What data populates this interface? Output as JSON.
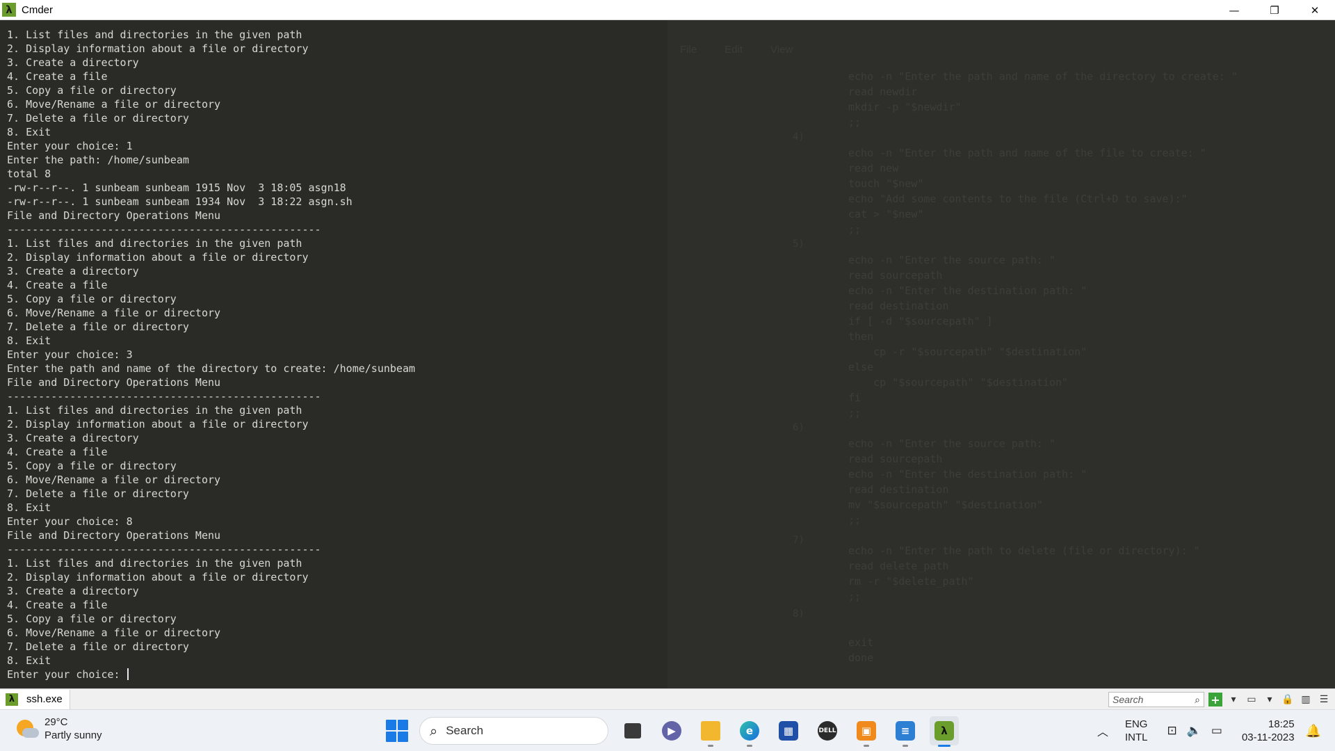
{
  "window": {
    "title": "Cmder",
    "app_icon": "λ",
    "controls": {
      "minimize": "—",
      "maximize": "❐",
      "close": "✕"
    }
  },
  "terminal": {
    "lines": [
      "1. List files and directories in the given path",
      "2. Display information about a file or directory",
      "3. Create a directory",
      "4. Create a file",
      "5. Copy a file or directory",
      "6. Move/Rename a file or directory",
      "7. Delete a file or directory",
      "8. Exit",
      "Enter your choice: 1",
      "Enter the path: /home/sunbeam",
      "total 8",
      "-rw-r--r--. 1 sunbeam sunbeam 1915 Nov  3 18:05 asgn18",
      "-rw-r--r--. 1 sunbeam sunbeam 1934 Nov  3 18:22 asgn.sh",
      "File and Directory Operations Menu",
      "--------------------------------------------------",
      "1. List files and directories in the given path",
      "2. Display information about a file or directory",
      "3. Create a directory",
      "4. Create a file",
      "5. Copy a file or directory",
      "6. Move/Rename a file or directory",
      "7. Delete a file or directory",
      "8. Exit",
      "Enter your choice: 3",
      "Enter the path and name of the directory to create: /home/sunbeam",
      "File and Directory Operations Menu",
      "--------------------------------------------------",
      "1. List files and directories in the given path",
      "2. Display information about a file or directory",
      "3. Create a directory",
      "4. Create a file",
      "5. Copy a file or directory",
      "6. Move/Rename a file or directory",
      "7. Delete a file or directory",
      "8. Exit",
      "Enter your choice: 8",
      "File and Directory Operations Menu",
      "--------------------------------------------------",
      "1. List files and directories in the given path",
      "2. Display information about a file or directory",
      "3. Create a directory",
      "4. Create a file",
      "5. Copy a file or directory",
      "6. Move/Rename a file or directory",
      "7. Delete a file or directory",
      "8. Exit"
    ],
    "prompt": "Enter your choice: "
  },
  "background_editor": {
    "menu": [
      "File",
      "Edit",
      "View"
    ],
    "line_markers": [
      "4)",
      "5)",
      "6)",
      "7)",
      "8)"
    ],
    "code_lines": [
      "echo -n \"Enter the path and name of the directory to create: \"",
      "read newdir",
      "mkdir -p \"$newdir\"",
      ";;",
      "",
      "echo -n \"Enter the path and name of the file to create: \"",
      "read new",
      "touch \"$new\"",
      "echo \"Add some contents to the file (Ctrl+D to save):\"",
      "cat > \"$new\"",
      ";;",
      "",
      "echo -n \"Enter the source path: \"",
      "read sourcepath",
      "echo -n \"Enter the destination path: \"",
      "read destination",
      "if [ -d \"$sourcepath\" ]",
      "then",
      "    cp -r \"$sourcepath\" \"$destination\"",
      "else",
      "    cp \"$sourcepath\" \"$destination\"",
      "fi",
      ";;",
      "",
      "echo -n \"Enter the source path: \"",
      "read sourcepath",
      "echo -n \"Enter the destination path: \"",
      "read destination",
      "mv \"$sourcepath\" \"$destination\"",
      ";;",
      "",
      "echo -n \"Enter the path to delete (file or directory): \"",
      "read delete_path",
      "rm -r \"$delete_path\"",
      ";;",
      "",
      "",
      "exit",
      "done"
    ]
  },
  "statusbar": {
    "tab_label": "ssh.exe",
    "tab_icon": "λ",
    "search_placeholder": "Search"
  },
  "taskbar": {
    "weather": {
      "temp": "29°C",
      "condition": "Partly sunny"
    },
    "search_label": "Search",
    "lang_line1": "ENG",
    "lang_line2": "INTL",
    "time": "18:25",
    "date": "03-11-2023",
    "colors": {
      "accent": "#1a7ae6",
      "cmder_green": "#6b9d2c"
    }
  }
}
